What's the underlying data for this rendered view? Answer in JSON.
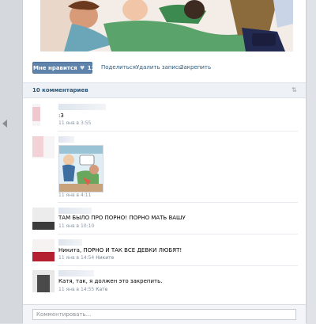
{
  "post": {
    "image_alt": "comic-illustration"
  },
  "actions": {
    "like_label": "Мне нравится",
    "like_heart": "♥",
    "like_count": "13",
    "share_label": "Поделиться",
    "delete_label": "Удалить запись",
    "pin_label": "Закрепить"
  },
  "comments_header": {
    "count_label": "10 комментариев"
  },
  "comments": [
    {
      "text": ":3",
      "time": "11 янв в 3:55",
      "reply_to": ""
    },
    {
      "text": "",
      "time": "11 янв в 4:11",
      "reply_to": ""
    },
    {
      "text": "ТАМ БЫЛО ПРО ПОРНО! ПОРНО МАТЬ ВАШУ",
      "time": "11 янв в 10:10",
      "reply_to": ""
    },
    {
      "text": "Никита, ПОРНО И ТАК ВСЕ ДЕВКИ ЛЮБЯТ!",
      "time": "11 янв в 14:54",
      "reply_to": "Никите"
    },
    {
      "text": "Катя, так, я должен это закрепить.",
      "time": "11 янв в 14:55",
      "reply_to": "Кате"
    }
  ],
  "input": {
    "placeholder": "Комментировать..."
  },
  "colors": {
    "like_button": "#5f83aa",
    "link": "#2b587a",
    "meta": "#8a95a3"
  }
}
